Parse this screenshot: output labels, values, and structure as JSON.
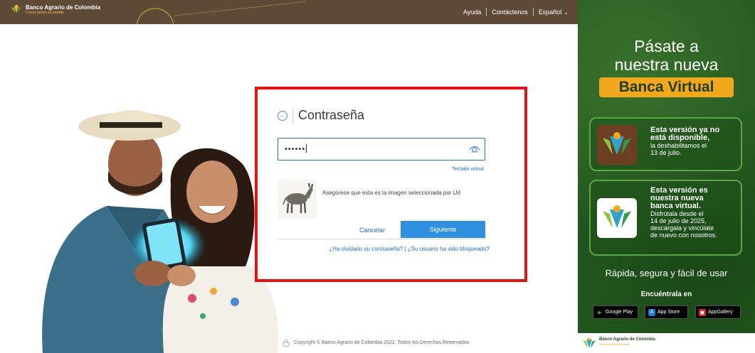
{
  "topbar": {
    "brand_name": "Banco Agrario de Colombia",
    "brand_tagline": "Crecer juntos es posible",
    "help": "Ayuda",
    "contact": "Contáctenos",
    "language": "Español"
  },
  "login": {
    "back_icon": "arrow-left-circle-icon",
    "title": "Contraseña",
    "password_value": "••••••",
    "eye_icon": "eye-icon",
    "virtual_keyboard": "Teclado virtual",
    "image_caption": "Asegúrese que esta es la imagen seleccionada por Ud",
    "cancel": "Cancelar",
    "next": "Siguiente",
    "forgot_password": "¿Ha olvidado su contraseña?",
    "link_separator": "|",
    "blocked_user": "¿Su usuario ha sido bloqueado?"
  },
  "footer": {
    "lock_icon": "lock-icon",
    "copyright": "Copyright © Banco Agrario de Colombia 2022. Todos los Derechos Reservados"
  },
  "promo": {
    "title_line1": "Pásate a",
    "title_line2": "nuestra nueva",
    "title_highlight": "Banca Virtual",
    "old": {
      "strong1": "Esta versión ya no",
      "strong2": "está disponible,",
      "small1": "la deshabilitamos el",
      "small2": "13 de julio."
    },
    "new": {
      "strong1": "Esta versión es",
      "strong2": "nuestra nueva",
      "strong3": "banca virtual.",
      "small1": "Disfrútala desde el",
      "small2": "14 de julio de 2025,",
      "small3": "descárgala y vincúlate",
      "small4": "de nuevo con nosotros."
    },
    "tagline": "Rápida, segura y fácil de usar",
    "find": "Encuéntrala en",
    "store_google": "Google Play",
    "store_apple": "App Store",
    "store_huawei": "AppGallery",
    "bottom_brand": "Banco Agrario de Colombia",
    "bottom_tagline": "Crecer juntos es posible"
  },
  "colors": {
    "topbar_bg": "#5f4a38",
    "accent_blue": "#2f8fdf",
    "link_blue": "#1d6fc8",
    "highlight_red": "#e41313",
    "promo_green": "#245a1e",
    "promo_orange": "#f2a81d"
  }
}
